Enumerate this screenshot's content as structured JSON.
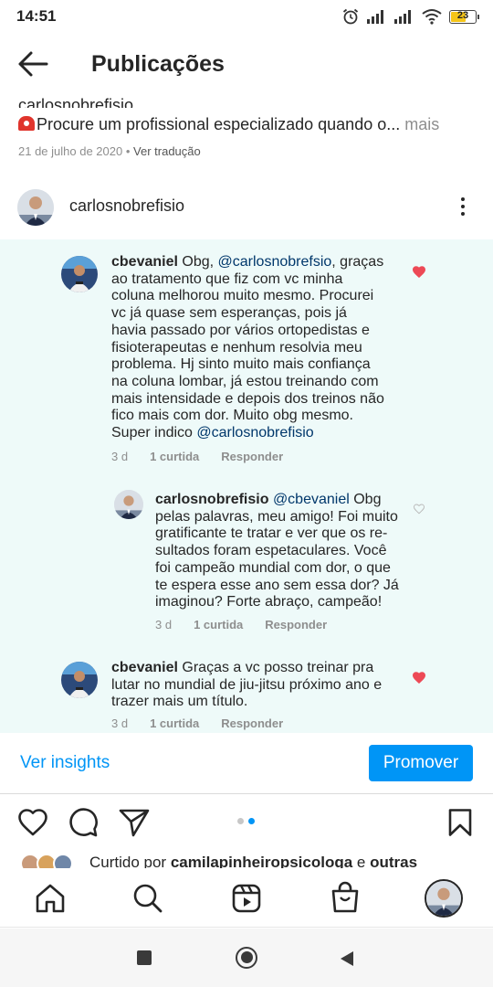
{
  "status_bar": {
    "time": "14:51",
    "battery_level": "23",
    "battery_color": "#f5c518"
  },
  "header": {
    "title": "Publicações",
    "back_icon": "arrow-left-icon"
  },
  "caption": {
    "partial_username": "carlosnobrefisio",
    "emoji_icon": "siren-icon",
    "text": "Procure um profissional especializado quando o...",
    "more_label": "mais",
    "date": "21 de julho de 2020",
    "separator": "•",
    "translate_label": "Ver tradução"
  },
  "post": {
    "username": "carlosnobrefisio",
    "more_icon": "more-vertical-icon"
  },
  "comments": [
    {
      "username": "cbevaniel",
      "mention_1": "@carlosnobrefsio",
      "text_1": "Obg,",
      "text_2": ", graças ao tratamento que fiz com vc minha coluna melhorou muito mesmo. Procurei vc já quase sem esperanças, pois já havia passado por vários ortopedistas e fisioterapeutas e nenhum resolvia meu problema. Hj sinto muito mais confiança na coluna lombar, já estou treinando com mais intensidade e depois dos treinos não fico mais com dor. Muito obg mesmo. Super indico",
      "mention_2": "@carlosnobrefisio",
      "time": "3 d",
      "likes": "1 curtida",
      "reply_label": "Responder",
      "liked": true
    },
    {
      "username": "carlosnobrefisio",
      "mention_1": "@cbevaniel",
      "text": "Obg pelas palavras, meu amigo! Foi muito gratificante te tratar e ver que os re-sultados foram espetaculares. Você foi campeão mundial com dor, o que te espera esse ano sem essa dor? Já imaginou? Forte abraço, campeão!",
      "time": "3 d",
      "likes": "1 curtida",
      "reply_label": "Responder",
      "liked": false
    },
    {
      "username": "cbevaniel",
      "text": "Graças a vc posso treinar pra lutar no mundial de jiu-jitsu próximo ano e trazer mais um título.",
      "time": "3 d",
      "likes": "1 curtida",
      "reply_label": "Responder",
      "liked": true
    }
  ],
  "insights": {
    "link_label": "Ver insights",
    "promote_label": "Promover"
  },
  "actions": {
    "like_icon": "heart-icon",
    "comment_icon": "comment-icon",
    "share_icon": "send-icon",
    "save_icon": "bookmark-icon",
    "carousel_index": "2"
  },
  "liked_by": {
    "prefix": "Curtido por",
    "user": "camilapinheiropsicologa",
    "connector": "e",
    "others": "outras"
  },
  "bottom_nav": {
    "items": [
      "home-icon",
      "search-icon",
      "reels-icon",
      "shop-icon",
      "profile-avatar"
    ]
  },
  "colors": {
    "accent": "#0095f6",
    "heart_red": "#ed4956",
    "comments_bg": "#eefaf9"
  }
}
